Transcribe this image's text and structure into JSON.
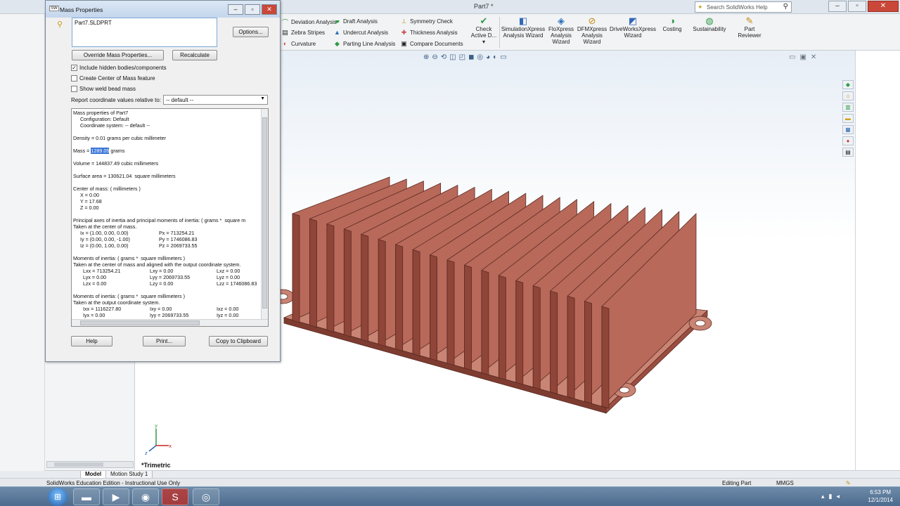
{
  "app": {
    "document_title": "Part7 *",
    "search_placeholder": "Search SolidWorks Help"
  },
  "ribbon": {
    "col1": [
      "Deviation Analysis",
      "Zebra Stripes",
      "Curvature"
    ],
    "col2": [
      "Draft Analysis",
      "Undercut Analysis",
      "Parting Line Analysis"
    ],
    "col3": [
      "Symmetry Check",
      "Thickness Analysis",
      "Compare Documents"
    ],
    "check_active": [
      "Check",
      "Active D..."
    ],
    "big_buttons": [
      {
        "label1": "SimulationXpress",
        "label2": "Analysis Wizard",
        "label3": ""
      },
      {
        "label1": "FloXpress",
        "label2": "Analysis",
        "label3": "Wizard"
      },
      {
        "label1": "DFMXpress",
        "label2": "Analysis",
        "label3": "Wizard"
      },
      {
        "label1": "DriveWorksXpress",
        "label2": "Wizard",
        "label3": ""
      },
      {
        "label1": "Costing",
        "label2": "",
        "label3": ""
      },
      {
        "label1": "Sustainability",
        "label2": "",
        "label3": ""
      },
      {
        "label1": "Part",
        "label2": "Reviewer",
        "label3": ""
      }
    ]
  },
  "dialog": {
    "title": "Mass Properties",
    "selection": "Part7.SLDPRT",
    "options_label": "Options...",
    "override_label": "Override Mass Properties...",
    "recalc_label": "Recalculate",
    "chk_hidden": "Include hidden bodies/components",
    "chk_com": "Create Center of Mass feature",
    "chk_weld": "Show weld bead mass",
    "report_label": "Report coordinate values relative to:",
    "coord_value": "-- default --",
    "help_label": "Help",
    "print_label": "Print...",
    "copy_label": "Copy to Clipboard"
  },
  "results": {
    "l1": "Mass properties of Part7",
    "l2": "     Configuration: Default",
    "l3": "     Coordinate system: -- default --",
    "density": "Density = 0.01 grams per cubic millimeter",
    "mass_prefix": "Mass = ",
    "mass_value": "1289.05",
    "mass_suffix": " grams",
    "volume": "Volume = 144837.49 cubic millimeters",
    "area": "Surface area = 130621.04  square millimeters",
    "com_head": "Center of mass: ( millimeters )",
    "cx": "     X = 0.00",
    "cy": "     Y = 17.68",
    "cz": "     Z = 0.00",
    "pa_head": "Principal axes of inertia and principal moments of inertia: ( grams *  square m",
    "pa_sub": "Taken at the center of mass.",
    "ix": "     Ix = (1.00, 0.00, 0.00)",
    "iy": "     Iy = (0.00, 0.00, -1.00)",
    "iz": "     Iz = (0.00, 1.00, 0.00)",
    "px": "Px = 713254.21",
    "py": "Py = 1746086.83",
    "pz": "Pz = 2069733.55",
    "mi1_head": "Moments of inertia: ( grams *  square millimeters )",
    "mi1_sub": "Taken at the center of mass and aligned with the output coordinate system.",
    "lxx": "Lxx = 713254.21",
    "lxy": "Lxy = 0.00",
    "lxz": "Lxz = 0.00",
    "lyx": "Lyx = 0.00",
    "lyy": "Lyy = 2069733.55",
    "lyz": "Lyz = 0.00",
    "lzx": "Lzx = 0.00",
    "lzy": "Lzy = 0.00",
    "lzz": "Lzz = 1746086.83",
    "mi2_head": "Moments of inertia: ( grams *  square millimeters )",
    "mi2_sub": "Taken at the output coordinate system.",
    "ixx": "Ixx = 1116227.80",
    "ixy": "Ixy = 0.00",
    "ixz": "Ixz = 0.00",
    "iyx": "Iyx = 0.00",
    "iyy": "Iyy = 2069733.55",
    "iyz": "Iyz = 0.00"
  },
  "viewport": {
    "view_name": "*Trimetric"
  },
  "tabs": [
    "Model",
    "Motion Study 1"
  ],
  "status": {
    "left": "SolidWorks Education Edition - Instructional Use Only",
    "mode": "Editing Part",
    "units": "MMGS"
  },
  "taskbar": {
    "time": "6:53 PM",
    "date": "12/1/2014"
  },
  "colors": {
    "model": "#b8695a",
    "accent": "#3875d7"
  }
}
